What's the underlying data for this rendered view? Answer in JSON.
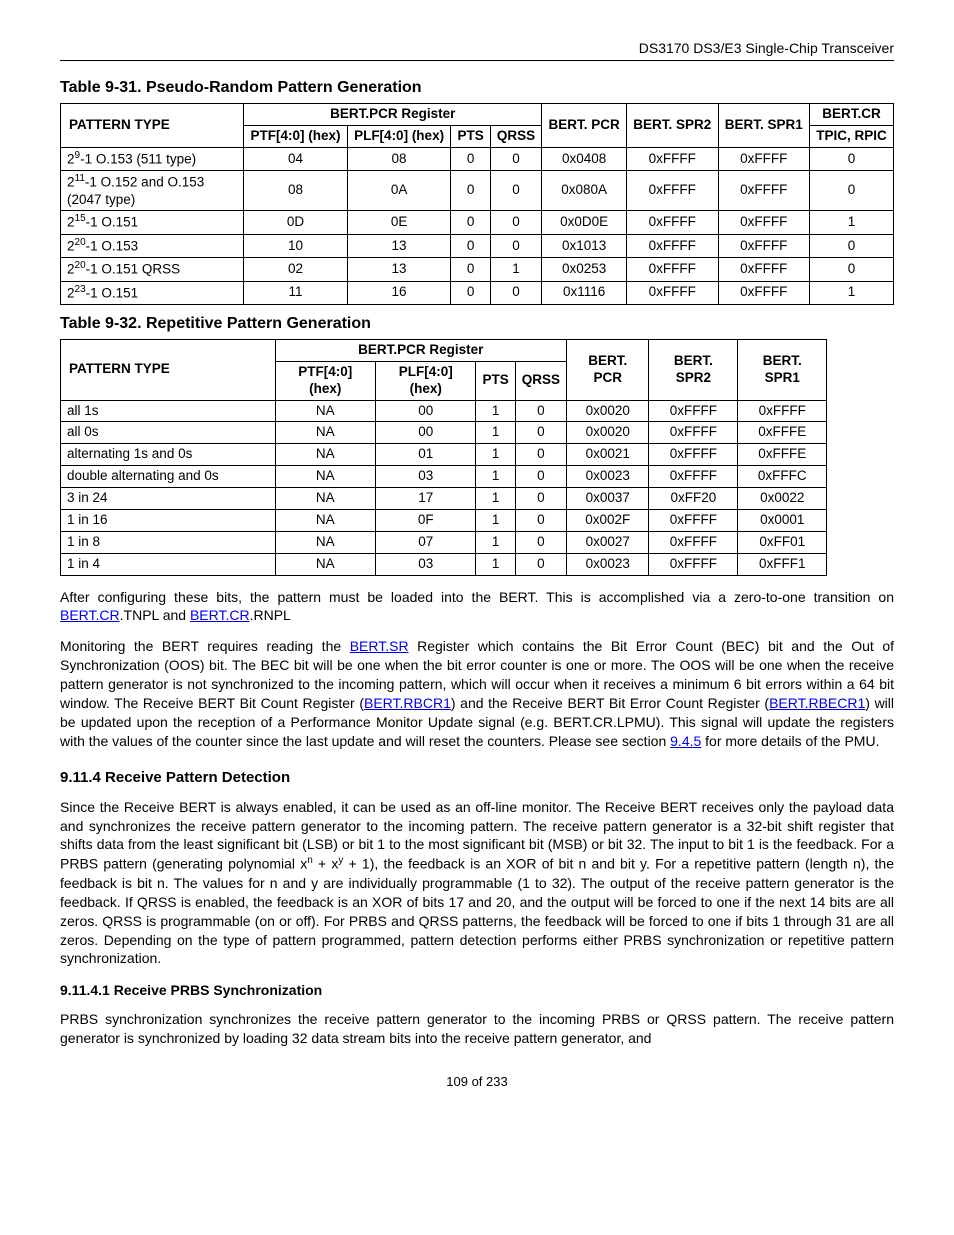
{
  "header": "DS3170 DS3/E3 Single-Chip Transceiver",
  "table1": {
    "title": "Table 9-31. Pseudo-Random Pattern Generation",
    "group_header": "BERT.PCR Register",
    "pattern_type_label": "PATTERN TYPE",
    "cols": {
      "ptf": "PTF[4:0] (hex)",
      "plf": "PLF[4:0] (hex)",
      "pts": "PTS",
      "qrss": "QRSS",
      "pcr": "BERT. PCR",
      "spr2": "BERT. SPR2",
      "spr1": "BERT. SPR1",
      "bertcr": "BERT.CR",
      "tpic": "TPIC, RPIC"
    },
    "rows": [
      {
        "pat_pre": "2",
        "pat_sup": "9",
        "pat_post": "-1  O.153 (511 type)",
        "ptf": "04",
        "plf": "08",
        "pts": "0",
        "qrss": "0",
        "pcr": "0x0408",
        "spr2": "0xFFFF",
        "spr1": "0xFFFF",
        "tpic": "0"
      },
      {
        "pat_pre": "2",
        "pat_sup": "11",
        "pat_post": "-1  O.152 and O.153 (2047 type)",
        "ptf": "08",
        "plf": "0A",
        "pts": "0",
        "qrss": "0",
        "pcr": "0x080A",
        "spr2": "0xFFFF",
        "spr1": "0xFFFF",
        "tpic": "0"
      },
      {
        "pat_pre": "2",
        "pat_sup": "15",
        "pat_post": "-1  O.151",
        "ptf": "0D",
        "plf": "0E",
        "pts": "0",
        "qrss": "0",
        "pcr": "0x0D0E",
        "spr2": "0xFFFF",
        "spr1": "0xFFFF",
        "tpic": "1"
      },
      {
        "pat_pre": "2",
        "pat_sup": "20",
        "pat_post": "-1  O.153",
        "ptf": "10",
        "plf": "13",
        "pts": "0",
        "qrss": "0",
        "pcr": "0x1013",
        "spr2": "0xFFFF",
        "spr1": "0xFFFF",
        "tpic": "0"
      },
      {
        "pat_pre": "2",
        "pat_sup": "20",
        "pat_post": "-1  O.151 QRSS",
        "ptf": "02",
        "plf": "13",
        "pts": "0",
        "qrss": "1",
        "pcr": "0x0253",
        "spr2": "0xFFFF",
        "spr1": "0xFFFF",
        "tpic": "0"
      },
      {
        "pat_pre": "2",
        "pat_sup": "23",
        "pat_post": "-1  O.151",
        "ptf": "11",
        "plf": "16",
        "pts": "0",
        "qrss": "0",
        "pcr": "0x1116",
        "spr2": "0xFFFF",
        "spr1": "0xFFFF",
        "tpic": "1"
      }
    ]
  },
  "table2": {
    "title": "Table 9-32. Repetitive Pattern Generation",
    "group_header": "BERT.PCR Register",
    "pattern_type_label": "PATTERN TYPE",
    "cols": {
      "ptf": "PTF[4:0] (hex)",
      "plf": "PLF[4:0] (hex)",
      "pts": "PTS",
      "qrss": "QRSS",
      "pcr": "BERT. PCR",
      "spr2": "BERT. SPR2",
      "spr1": "BERT. SPR1"
    },
    "rows": [
      {
        "pat": "all 1s",
        "ptf": "NA",
        "plf": "00",
        "pts": "1",
        "qrss": "0",
        "pcr": "0x0020",
        "spr2": "0xFFFF",
        "spr1": "0xFFFF"
      },
      {
        "pat": "all 0s",
        "ptf": "NA",
        "plf": "00",
        "pts": "1",
        "qrss": "0",
        "pcr": "0x0020",
        "spr2": "0xFFFF",
        "spr1": "0xFFFE"
      },
      {
        "pat": "alternating 1s and 0s",
        "ptf": "NA",
        "plf": "01",
        "pts": "1",
        "qrss": "0",
        "pcr": "0x0021",
        "spr2": "0xFFFF",
        "spr1": "0xFFFE"
      },
      {
        "pat": "double alternating and 0s",
        "ptf": "NA",
        "plf": "03",
        "pts": "1",
        "qrss": "0",
        "pcr": "0x0023",
        "spr2": "0xFFFF",
        "spr1": "0xFFFC"
      },
      {
        "pat": "3 in 24",
        "ptf": "NA",
        "plf": "17",
        "pts": "1",
        "qrss": "0",
        "pcr": "0x0037",
        "spr2": "0xFF20",
        "spr1": "0x0022"
      },
      {
        "pat": "1 in 16",
        "ptf": "NA",
        "plf": "0F",
        "pts": "1",
        "qrss": "0",
        "pcr": "0x002F",
        "spr2": "0xFFFF",
        "spr1": "0x0001"
      },
      {
        "pat": "1 in 8",
        "ptf": "NA",
        "plf": "07",
        "pts": "1",
        "qrss": "0",
        "pcr": "0x0027",
        "spr2": "0xFFFF",
        "spr1": "0xFF01"
      },
      {
        "pat": "1 in 4",
        "ptf": "NA",
        "plf": "03",
        "pts": "1",
        "qrss": "0",
        "pcr": "0x0023",
        "spr2": "0xFFFF",
        "spr1": "0xFFF1"
      }
    ]
  },
  "para1": {
    "pre": "After configuring these bits, the pattern must be loaded into the BERT.  This is accomplished via a zero-to-one transition on ",
    "link1": "BERT.CR",
    "mid1": ".TNPL and ",
    "link2": "BERT.CR",
    "post": ".RNPL"
  },
  "para2": {
    "pre": "Monitoring the BERT requires reading the ",
    "link1": "BERT.SR",
    "mid1": " Register which contains the Bit Error Count (BEC) bit and the Out of Synchronization (OOS) bit.  The BEC bit will be one when the bit error counter is one or more.  The OOS will be one when the receive pattern generator is not synchronized to the incoming pattern, which will occur when it receives a minimum 6 bit errors within a 64 bit window.  The Receive BERT Bit Count Register (",
    "link2": "BERT.RBCR1",
    "mid2": ") and the Receive BERT Bit Error Count Register (",
    "link3": "BERT.RBECR1",
    "mid3": ") will be updated upon the reception of a Performance Monitor Update signal (e.g. BERT.CR.LPMU).  This signal will update the registers with the values of the counter since the last update and will reset the counters.  Please see section ",
    "link4": "9.4.5",
    "post": " for more details of the PMU."
  },
  "sec_heading": "9.11.4  Receive Pattern Detection",
  "para3": {
    "pre": "Since the Receive BERT is always enabled, it can be used as an off-line monitor.  The Receive BERT receives only the payload data and synchronizes the receive pattern generator to the incoming pattern. The receive pattern generator is a 32-bit shift register that shifts data from the least significant bit (LSB) or bit 1 to the most significant bit (MSB) or bit 32. The input to bit 1 is the feedback. For a PRBS pattern (generating polynomial x",
    "supn": "n",
    "mid1": " + x",
    "supy": "y",
    "post": " + 1), the feedback is an XOR of bit n and bit y. For a repetitive pattern (length n), the feedback is bit n. The values for n and y are individually programmable (1 to 32). The output of the receive pattern generator is the feedback. If QRSS is enabled, the feedback is an XOR of bits 17 and 20, and the output will be forced to one if the next 14 bits are all zeros. QRSS is programmable (on or off). For PRBS and QRSS patterns, the feedback will be forced to one if bits 1 through 31 are all zeros. Depending on the type of pattern programmed, pattern detection performs either PRBS synchronization or repetitive pattern synchronization."
  },
  "sub_heading": "9.11.4.1   Receive PRBS Synchronization",
  "para4": "PRBS synchronization synchronizes the receive pattern generator to the incoming PRBS or QRSS pattern. The receive pattern generator is synchronized by loading 32 data stream bits into the receive pattern generator, and",
  "footer": "109 of 233"
}
